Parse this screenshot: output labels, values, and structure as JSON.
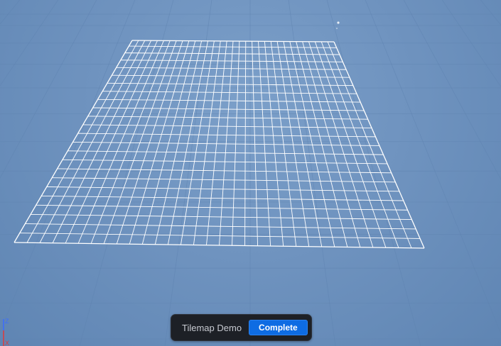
{
  "status_panel": {
    "title": "Tilemap Demo",
    "button_label": "Complete",
    "button_color": "#0e6ce3"
  },
  "axis_gizmo": {
    "z_label": "Z",
    "x_label": "X"
  },
  "scene": {
    "background_color": "#6f93bf",
    "ground_grid_color": "#5f84b0",
    "tilemap_line_color": "#ffffff",
    "tilemap_columns": 32,
    "tilemap_rows": 24
  },
  "icons": {
    "scene_marker": "light-marker-icon",
    "gizmo": "axis-gizmo-icon"
  }
}
